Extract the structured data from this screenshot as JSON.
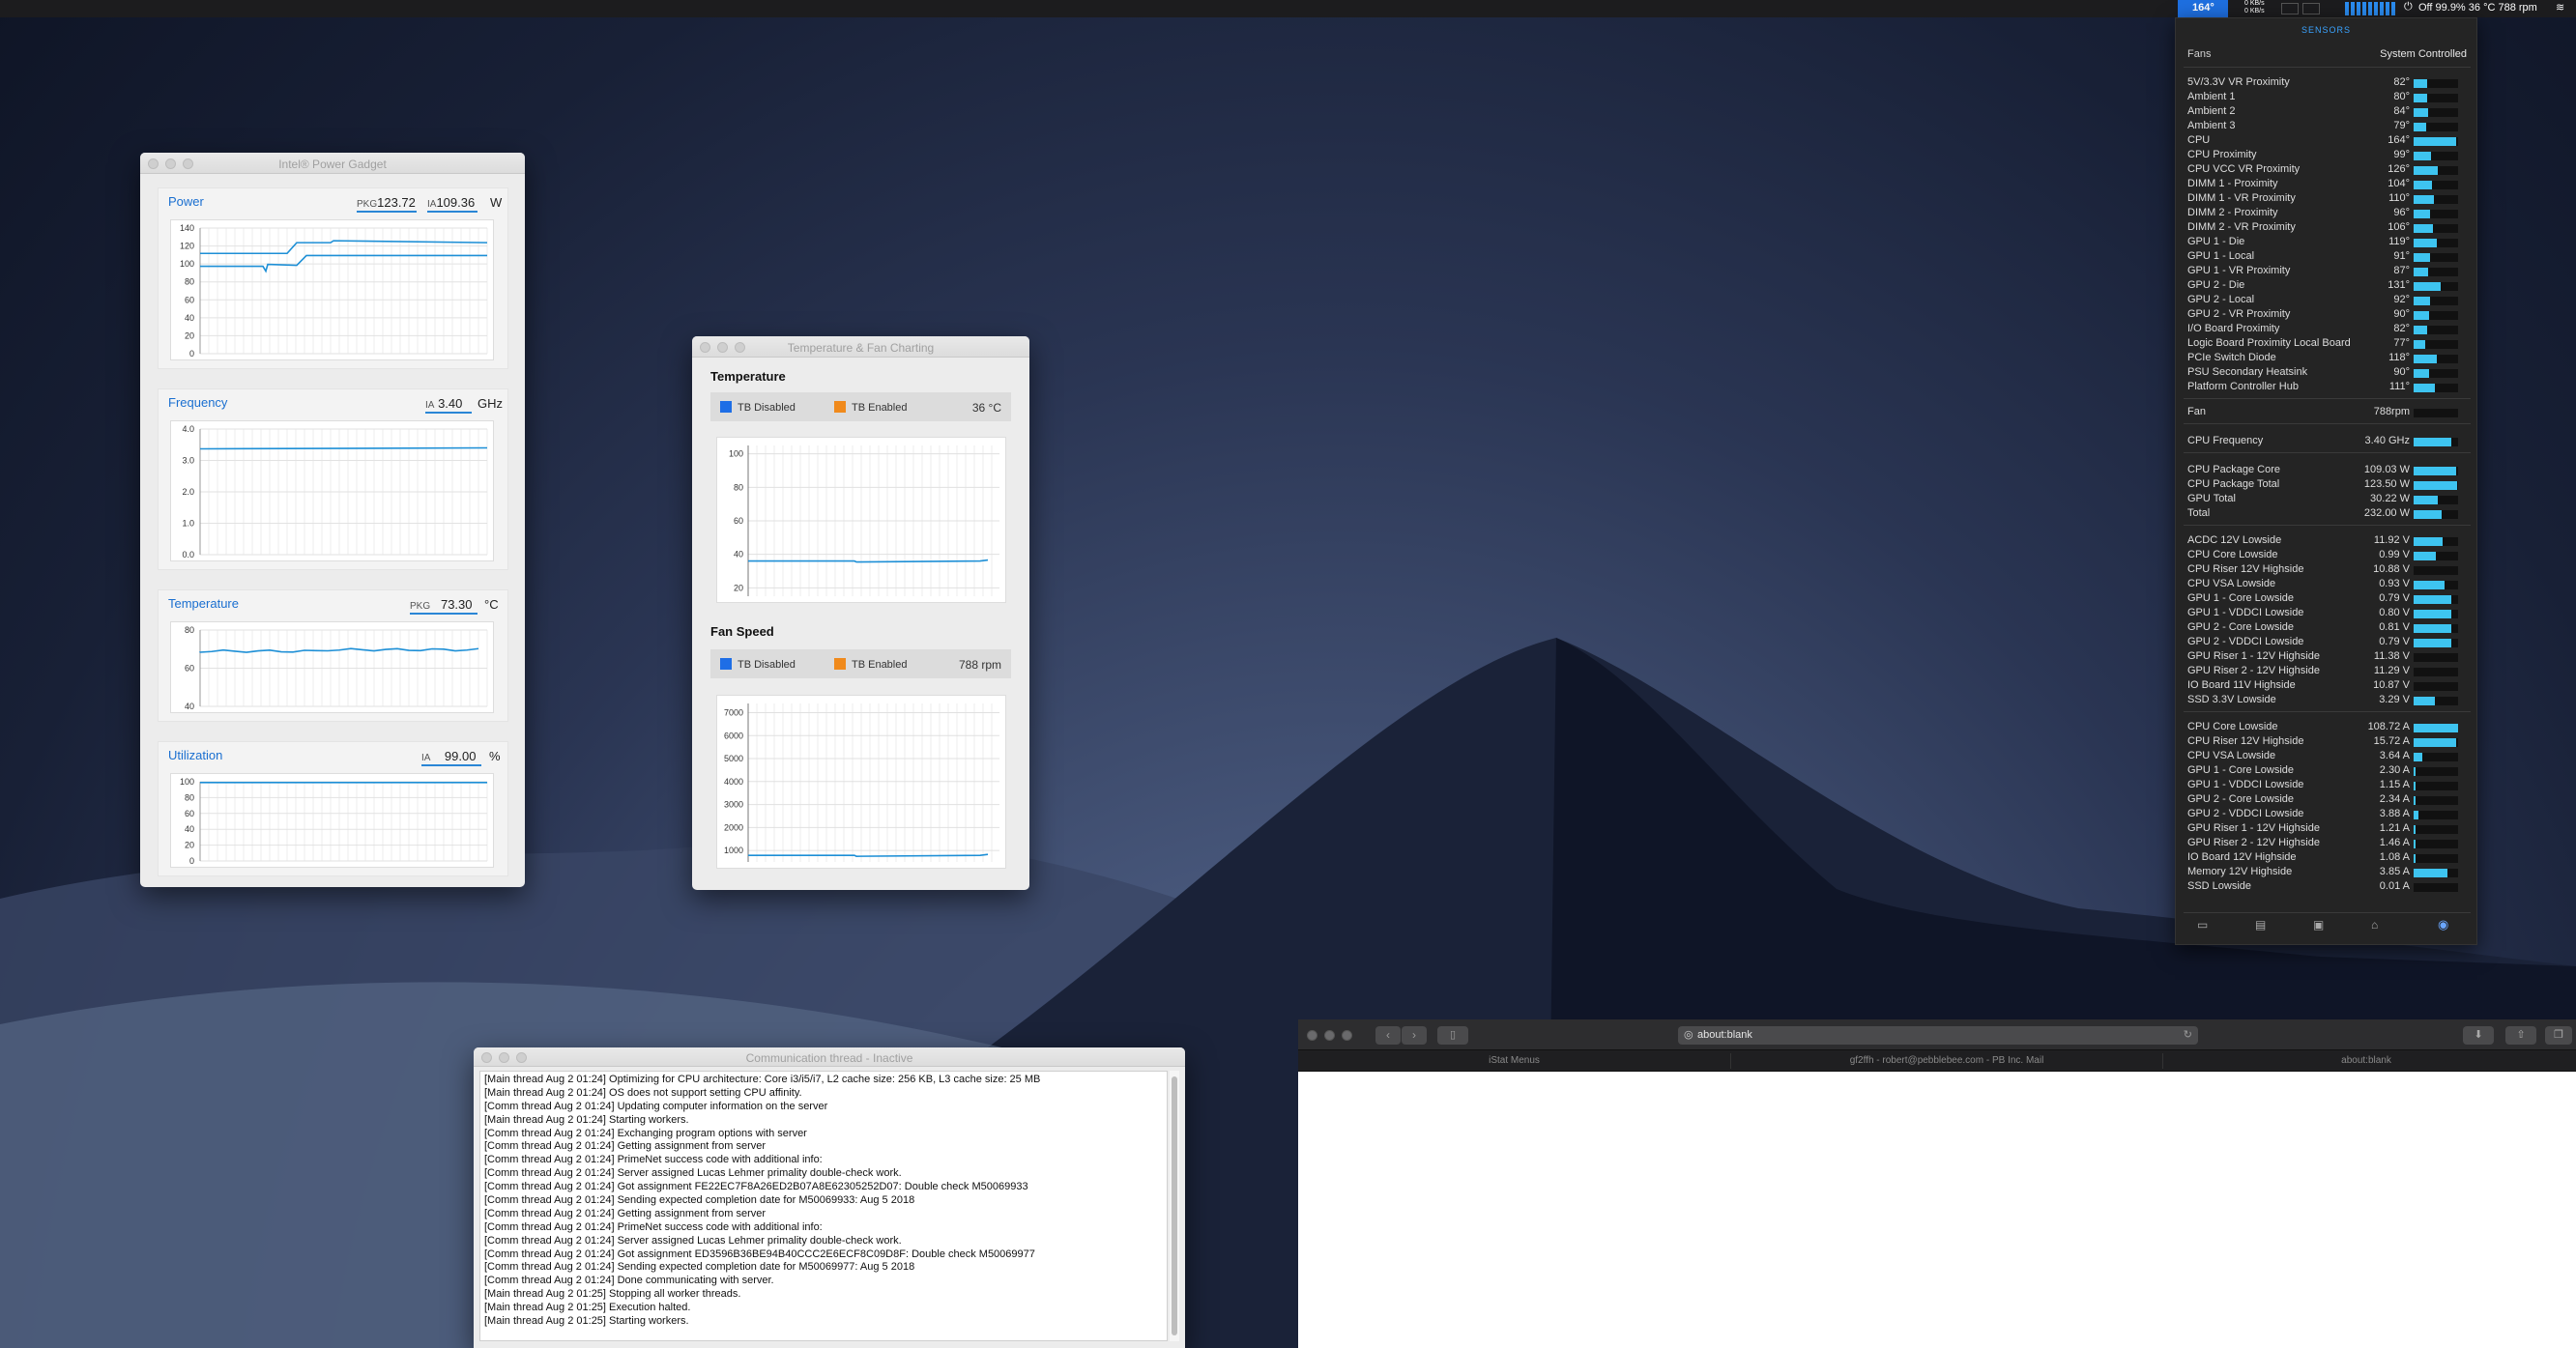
{
  "menubar": {
    "cpu_temp": "164°",
    "net_up": "0 KB/s",
    "net_down": "0 KB/s",
    "status": "Off 99.9% 36 °C 788 rpm"
  },
  "power_gadget": {
    "title": "Intel® Power Gadget",
    "power": {
      "label": "Power",
      "pkg_prefix": "PKG",
      "pkg_value": "123.72",
      "ia_prefix": "IA",
      "ia_value": "109.36",
      "unit": "W",
      "ticks": [
        "140",
        "120",
        "100",
        "80",
        "60",
        "40",
        "20",
        "0"
      ],
      "pkg_level": 123.72,
      "ia_level": 109.36,
      "max": 140
    },
    "frequency": {
      "label": "Frequency",
      "ia_prefix": "IA",
      "ia_value": "3.40",
      "unit": "GHz",
      "ticks": [
        "4.0",
        "3.0",
        "2.0",
        "1.0",
        "0.0"
      ],
      "level": 3.4,
      "max": 4.0
    },
    "temperature": {
      "label": "Temperature",
      "pkg_prefix": "PKG",
      "pkg_value": "73.30",
      "unit": "°C",
      "ticks": [
        "80",
        "60",
        "40"
      ],
      "level": 73.3,
      "max": 88,
      "min": 35
    },
    "utilization": {
      "label": "Utilization",
      "ia_prefix": "IA",
      "ia_value": "99.00",
      "unit": "%",
      "ticks": [
        "100",
        "80",
        "60",
        "40",
        "20",
        "0"
      ],
      "level": 99,
      "max": 100
    }
  },
  "temp_fan": {
    "title": "Temperature & Fan Charting",
    "temperature": {
      "heading": "Temperature",
      "legend_disabled": "TB Disabled",
      "legend_enabled": "TB Enabled",
      "current": "36 °C",
      "ticks": [
        "100",
        "80",
        "60",
        "40",
        "20"
      ],
      "level": 36,
      "min": 15,
      "max": 105
    },
    "fan": {
      "heading": "Fan Speed",
      "legend_disabled": "TB Disabled",
      "legend_enabled": "TB Enabled",
      "current": "788 rpm",
      "ticks": [
        "7000",
        "6000",
        "5000",
        "4000",
        "3000",
        "2000",
        "1000"
      ],
      "level": 788,
      "min": 500,
      "max": 7400
    },
    "color_disabled": "#1e6ee6",
    "color_enabled": "#f08a1c"
  },
  "comm": {
    "title": "Communication thread - Inactive",
    "lines": [
      "[Main thread Aug 2 01:24] Optimizing for CPU architecture: Core i3/i5/i7, L2 cache size: 256 KB, L3 cache size: 25 MB",
      "[Main thread Aug 2 01:24] OS does not support setting CPU affinity.",
      "[Comm thread Aug 2 01:24] Updating computer information on the server",
      "[Main thread Aug 2 01:24] Starting workers.",
      "[Comm thread Aug 2 01:24] Exchanging program options with server",
      "[Comm thread Aug 2 01:24] Getting assignment from server",
      "[Comm thread Aug 2 01:24] PrimeNet success code with additional info:",
      "[Comm thread Aug 2 01:24] Server assigned Lucas Lehmer primality double-check work.",
      "[Comm thread Aug 2 01:24] Got assignment FE22EC7F8A26ED2B07A8E62305252D07: Double check M50069933",
      "[Comm thread Aug 2 01:24] Sending expected completion date for M50069933: Aug  5 2018",
      "[Comm thread Aug 2 01:24] Getting assignment from server",
      "[Comm thread Aug 2 01:24] PrimeNet success code with additional info:",
      "[Comm thread Aug 2 01:24] Server assigned Lucas Lehmer primality double-check work.",
      "[Comm thread Aug 2 01:24] Got assignment ED3596B36BE94B40CCC2E6ECF8C09D8F: Double check M50069977",
      "[Comm thread Aug 2 01:24] Sending expected completion date for M50069977: Aug  5 2018",
      "[Comm thread Aug 2 01:24] Done communicating with server.",
      "[Main thread Aug 2 01:25] Stopping all worker threads.",
      "[Main thread Aug 2 01:25] Execution halted.",
      "[Main thread Aug 2 01:25] Starting workers."
    ]
  },
  "istat": {
    "header": "SENSORS",
    "fans_label": "Fans",
    "fans_mode": "System Controlled",
    "temps": [
      {
        "name": "5V/3.3V VR Proximity",
        "value": "82°",
        "pct": 0.3
      },
      {
        "name": "Ambient 1",
        "value": "80°",
        "pct": 0.3
      },
      {
        "name": "Ambient 2",
        "value": "84°",
        "pct": 0.32
      },
      {
        "name": "Ambient 3",
        "value": "79°",
        "pct": 0.28
      },
      {
        "name": "CPU",
        "value": "164°",
        "pct": 0.95
      },
      {
        "name": "CPU Proximity",
        "value": "99°",
        "pct": 0.4
      },
      {
        "name": "CPU VCC VR Proximity",
        "value": "126°",
        "pct": 0.55
      },
      {
        "name": "DIMM 1 - Proximity",
        "value": "104°",
        "pct": 0.42
      },
      {
        "name": "DIMM 1 - VR Proximity",
        "value": "110°",
        "pct": 0.46
      },
      {
        "name": "DIMM 2 - Proximity",
        "value": "96°",
        "pct": 0.38
      },
      {
        "name": "DIMM 2 - VR Proximity",
        "value": "106°",
        "pct": 0.44
      },
      {
        "name": "GPU 1 - Die",
        "value": "119°",
        "pct": 0.52
      },
      {
        "name": "GPU 1 - Local",
        "value": "91°",
        "pct": 0.36
      },
      {
        "name": "GPU 1 - VR Proximity",
        "value": "87°",
        "pct": 0.33
      },
      {
        "name": "GPU 2 - Die",
        "value": "131°",
        "pct": 0.6
      },
      {
        "name": "GPU 2 - Local",
        "value": "92°",
        "pct": 0.36
      },
      {
        "name": "GPU 2 - VR Proximity",
        "value": "90°",
        "pct": 0.35
      },
      {
        "name": "I/O Board Proximity",
        "value": "82°",
        "pct": 0.3
      },
      {
        "name": "Logic Board Proximity Local Board",
        "value": "77°",
        "pct": 0.27
      },
      {
        "name": "PCIe Switch Diode",
        "value": "118°",
        "pct": 0.52
      },
      {
        "name": "PSU Secondary Heatsink",
        "value": "90°",
        "pct": 0.35
      },
      {
        "name": "Platform Controller Hub",
        "value": "111°",
        "pct": 0.47
      }
    ],
    "fan": {
      "name": "Fan",
      "value": "788rpm",
      "pct": 0.0
    },
    "cpu_freq": {
      "name": "CPU Frequency",
      "value": "3.40 GHz",
      "pct": 0.85
    },
    "power": [
      {
        "name": "CPU Package Core",
        "value": "109.03 W",
        "pct": 0.95
      },
      {
        "name": "CPU Package Total",
        "value": "123.50 W",
        "pct": 0.98
      },
      {
        "name": "GPU Total",
        "value": "30.22 W",
        "pct": 0.55
      },
      {
        "name": "Total",
        "value": "232.00 W",
        "pct": 0.62
      }
    ],
    "voltages": [
      {
        "name": "ACDC 12V Lowside",
        "value": "11.92 V",
        "pct": 0.65
      },
      {
        "name": "CPU Core Lowside",
        "value": "0.99 V",
        "pct": 0.5
      },
      {
        "name": "CPU Riser 12V Highside",
        "value": "10.88 V",
        "pct": 0.0
      },
      {
        "name": "CPU VSA Lowside",
        "value": "0.93 V",
        "pct": 0.7
      },
      {
        "name": "GPU 1 - Core Lowside",
        "value": "0.79 V",
        "pct": 0.85
      },
      {
        "name": "GPU 1 - VDDCI Lowside",
        "value": "0.80 V",
        "pct": 0.85
      },
      {
        "name": "GPU 2 - Core Lowside",
        "value": "0.81 V",
        "pct": 0.85
      },
      {
        "name": "GPU 2 - VDDCI Lowside",
        "value": "0.79 V",
        "pct": 0.85
      },
      {
        "name": "GPU Riser 1 - 12V Highside",
        "value": "11.38 V",
        "pct": 0.0
      },
      {
        "name": "GPU Riser 2 - 12V Highside",
        "value": "11.29 V",
        "pct": 0.0
      },
      {
        "name": "IO Board 11V Highside",
        "value": "10.87 V",
        "pct": 0.0
      },
      {
        "name": "SSD 3.3V Lowside",
        "value": "3.29 V",
        "pct": 0.48
      }
    ],
    "currents": [
      {
        "name": "CPU Core Lowside",
        "value": "108.72 A",
        "pct": 1.0
      },
      {
        "name": "CPU Riser 12V Highside",
        "value": "15.72 A",
        "pct": 0.95
      },
      {
        "name": "CPU VSA Lowside",
        "value": "3.64 A",
        "pct": 0.2
      },
      {
        "name": "GPU 1 - Core Lowside",
        "value": "2.30 A",
        "pct": 0.05
      },
      {
        "name": "GPU 1 - VDDCI Lowside",
        "value": "1.15 A",
        "pct": 0.05
      },
      {
        "name": "GPU 2 - Core Lowside",
        "value": "2.34 A",
        "pct": 0.05
      },
      {
        "name": "GPU 2 - VDDCI Lowside",
        "value": "3.88 A",
        "pct": 0.1
      },
      {
        "name": "GPU Riser 1 - 12V Highside",
        "value": "1.21 A",
        "pct": 0.05
      },
      {
        "name": "GPU Riser 2 - 12V Highside",
        "value": "1.46 A",
        "pct": 0.05
      },
      {
        "name": "IO Board 12V Highside",
        "value": "1.08 A",
        "pct": 0.05
      },
      {
        "name": "Memory 12V Highside",
        "value": "3.85 A",
        "pct": 0.75
      },
      {
        "name": "SSD Lowside",
        "value": "0.01 A",
        "pct": 0.0
      }
    ]
  },
  "safari": {
    "address": "about:blank",
    "tabs": [
      "iStat Menus",
      "gf2ffh - robert@pebblebee.com - PB Inc. Mail",
      "about:blank"
    ]
  }
}
